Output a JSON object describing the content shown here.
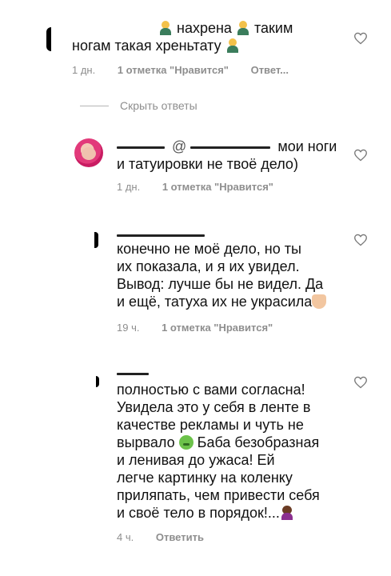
{
  "comments": [
    {
      "lines": [
        "нахрена",
        "таким",
        "ногам такая хреньтату"
      ],
      "time": "1 дн.",
      "likes": "1 отметка \"Нравится\"",
      "reply": "Ответ..."
    },
    {
      "hide_replies": "Скрыть ответы"
    },
    {
      "mention": "@",
      "line1": "мои ноги",
      "line2": "и татуировки не твоё дело)",
      "time": "1 дн.",
      "likes": "1 отметка \"Нравится\""
    },
    {
      "lines": [
        "конечно не моё дело, но ты",
        "их показала, и я их увидел.",
        "Вывод: лучше бы не видел. Да",
        "и ещё, татуха их не украсила"
      ],
      "time": "19 ч.",
      "likes": "1 отметка \"Нравится\""
    },
    {
      "lines": [
        "полностью с вами согласна!",
        "Увидела это у себя в ленте в",
        "качестве рекламы и чуть не",
        "вырвало",
        "Баба безобразная",
        "и ленивая до ужаса! Ей",
        "легче картинку на коленку",
        "приляпать, чем привести себя",
        "и своё тело в порядок!..."
      ],
      "time": "4 ч.",
      "reply": "Ответить"
    }
  ],
  "icons": {
    "like": "heart-outline-icon",
    "emoji_person": "man-facepalming-emoji",
    "emoji_sick": "nauseated-face-emoji",
    "emoji_woman": "woman-shrugging-emoji",
    "emoji_thumb": "thumbs-down-emoji"
  },
  "colors": {
    "text": "#111111",
    "meta": "#8e8e8e",
    "divider": "#b5b5b5",
    "avatar_accent": "#e23a7a"
  }
}
